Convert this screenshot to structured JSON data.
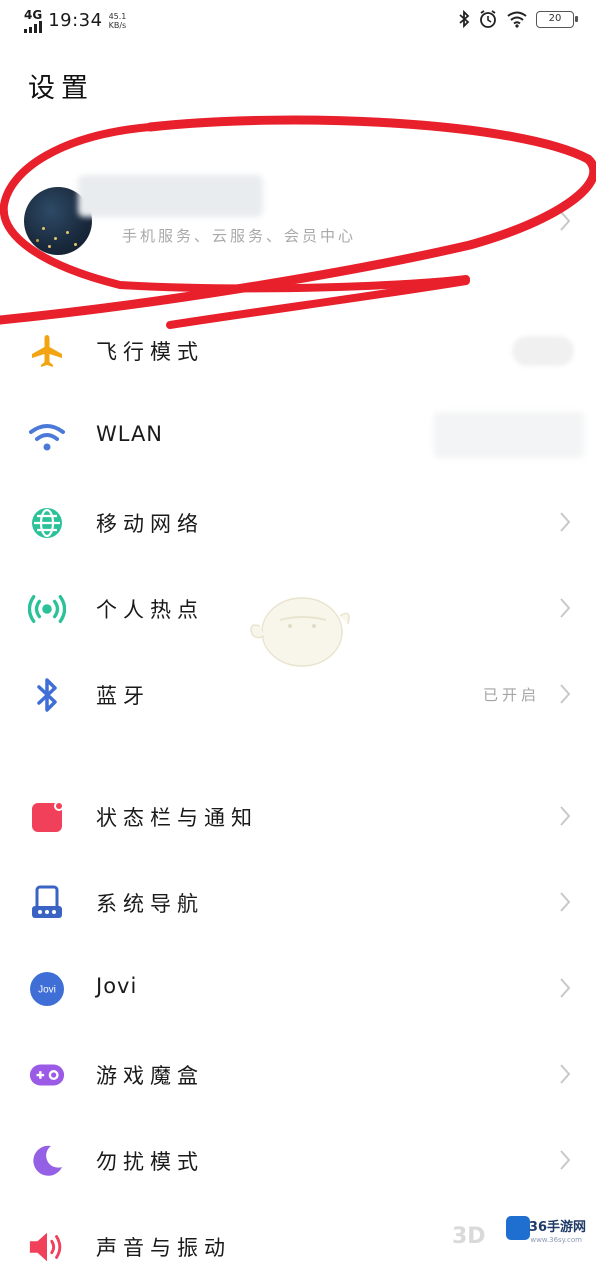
{
  "status_bar": {
    "network": "4G",
    "time": "19:34",
    "speed": "45.1 KB/s",
    "battery": "20"
  },
  "title": "设置",
  "account": {
    "subtitle": "手机服务、云服务、会员中心"
  },
  "colors": {
    "airplane": "#f3a412",
    "wifi": "#4a79d8",
    "mobile_network": "#2bc29a",
    "hotspot": "#2bc29a",
    "bluetooth": "#3f6fd6",
    "statusbar_notify": "#f0405a",
    "system_nav": "#3a63c4",
    "jovi": "#3f6fd6",
    "game_box": "#9b5be6",
    "dnd": "#9460e6",
    "sound": "#f0405a",
    "annotation_red": "#e8202c"
  },
  "rows": [
    {
      "label": "飞行模式",
      "icon": "airplane-icon"
    },
    {
      "label": "WLAN",
      "icon": "wifi-icon"
    },
    {
      "label": "移动网络",
      "icon": "globe-icon"
    },
    {
      "label": "个人热点",
      "icon": "hotspot-icon"
    },
    {
      "label": "蓝牙",
      "icon": "bluetooth-icon",
      "value": "已开启"
    },
    {
      "label": "状态栏与通知",
      "icon": "notification-icon"
    },
    {
      "label": "系统导航",
      "icon": "navigation-icon"
    },
    {
      "label": "Jovi",
      "icon": "jovi-icon",
      "icon_text": "Jovi"
    },
    {
      "label": "游戏魔盒",
      "icon": "gamepad-icon"
    },
    {
      "label": "勿扰模式",
      "icon": "moon-icon"
    },
    {
      "label": "声音与振动",
      "icon": "speaker-icon"
    }
  ],
  "watermark": {
    "brand": "36手游网",
    "url": "www.36sy.com",
    "faint": "3D"
  }
}
